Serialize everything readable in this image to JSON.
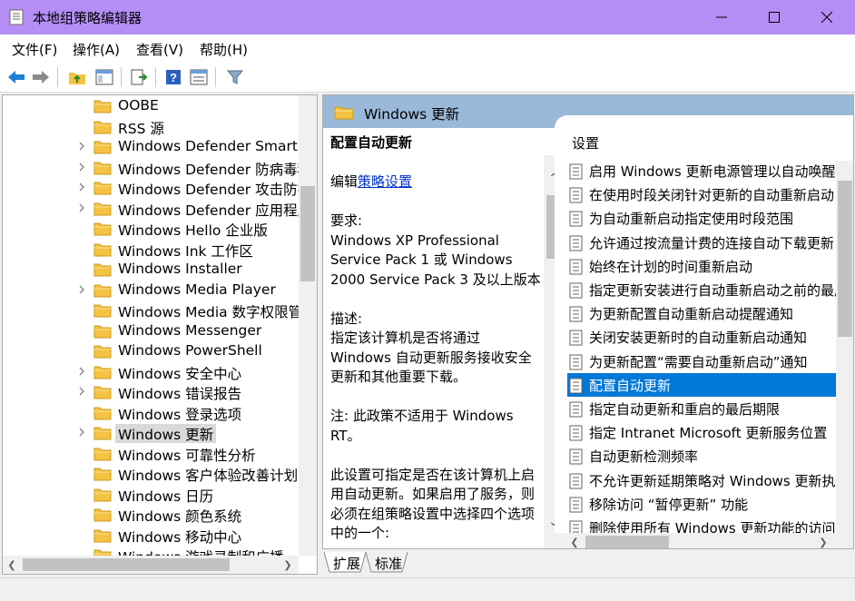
{
  "window": {
    "title": "本地组策略编辑器",
    "colors": {
      "titlebar": "#b48ef5",
      "selection": "#0078d7",
      "header": "#9ab8d8"
    }
  },
  "menu": [
    "文件(F)",
    "操作(A)",
    "查看(V)",
    "帮助(H)"
  ],
  "toolbar": [
    "back-arrow-icon",
    "forward-arrow-icon",
    "up-folder-icon",
    "show-hide-tree-icon",
    "export-list-icon",
    "help-icon",
    "properties-icon",
    "filter-icon"
  ],
  "tree": {
    "items": [
      {
        "label": "OOBE",
        "expandable": false
      },
      {
        "label": "RSS 源",
        "expandable": false
      },
      {
        "label": "Windows Defender SmartScreen",
        "expandable": true
      },
      {
        "label": "Windows Defender 防病毒程序",
        "expandable": true
      },
      {
        "label": "Windows Defender 攻击防护",
        "expandable": true
      },
      {
        "label": "Windows Defender 应用程序防护",
        "expandable": true
      },
      {
        "label": "Windows Hello 企业版",
        "expandable": false
      },
      {
        "label": "Windows Ink 工作区",
        "expandable": false
      },
      {
        "label": "Windows Installer",
        "expandable": false
      },
      {
        "label": "Windows Media Player",
        "expandable": true
      },
      {
        "label": "Windows Media 数字权限管理",
        "expandable": false
      },
      {
        "label": "Windows Messenger",
        "expandable": false
      },
      {
        "label": "Windows PowerShell",
        "expandable": false
      },
      {
        "label": "Windows 安全中心",
        "expandable": true
      },
      {
        "label": "Windows 错误报告",
        "expandable": true
      },
      {
        "label": "Windows 登录选项",
        "expandable": false
      },
      {
        "label": "Windows 更新",
        "expandable": true,
        "selected": true
      },
      {
        "label": "Windows 可靠性分析",
        "expandable": false
      },
      {
        "label": "Windows 客户体验改善计划",
        "expandable": false
      },
      {
        "label": "Windows 日历",
        "expandable": false
      },
      {
        "label": "Windows 颜色系统",
        "expandable": false
      },
      {
        "label": "Windows 移动中心",
        "expandable": false
      },
      {
        "label": "Windows 游戏录制和广播",
        "expandable": false
      }
    ]
  },
  "right": {
    "header": "Windows 更新",
    "description": {
      "title": "配置自动更新",
      "edit_prefix": "编辑",
      "edit_link": "策略设置",
      "requirements_label": "要求:",
      "requirements_text": "Windows XP Professional Service Pack 1 或 Windows 2000 Service Pack 3 及以上版本",
      "description_label": "描述:",
      "description_text": "指定该计算机是否将通过 Windows 自动更新服务接收安全更新和其他重要下载。",
      "note": "注: 此政策不适用于 Windows RT。",
      "extra": "此设置可指定是否在该计算机上启用自动更新。如果启用了服务，则必须在组策略设置中选择四个选项中的一个:"
    },
    "settings_header": "设置",
    "settings": [
      "启用 Windows 更新电源管理以自动唤醒系统来安装计划的更新",
      "在使用时段关闭针对更新的自动重新启动",
      "为自动重新启动指定使用时段范围",
      "允许通过按流量计费的连接自动下载更新",
      "始终在计划的时间重新启动",
      "指定更新安装进行自动重新启动之前的最后期限",
      "为更新配置自动重新启动提醒通知",
      "关闭安装更新时的自动重新启动通知",
      "为更新配置“需要自动重新启动”通知",
      "配置自动更新",
      "指定自动更新和重启的最后期限",
      "指定 Intranet Microsoft 更新服务位置",
      "自动更新检测频率",
      "不允许更新延期策略对 Windows 更新执行扫描",
      "移除访问 “暂停更新” 功能",
      "删除使用所有 Windows 更新功能的访问权限"
    ],
    "selected_index": 9
  },
  "tabs": [
    "扩展",
    "标准"
  ]
}
